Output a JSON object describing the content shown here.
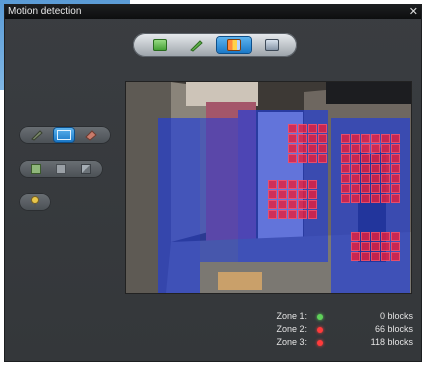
{
  "window": {
    "title": "Motion detection",
    "close_glyph": "✕"
  },
  "toolbar": {
    "buttons": [
      {
        "name": "export-icon",
        "active": false
      },
      {
        "name": "brush-icon",
        "active": false
      },
      {
        "name": "zones-icon",
        "active": true
      },
      {
        "name": "display-icon",
        "active": false
      }
    ]
  },
  "tools": {
    "group1": [
      "pencil-icon",
      "rectangle-icon",
      "eraser-icon"
    ],
    "group2": [
      "fill-icon",
      "clear-icon",
      "invert-icon"
    ],
    "group3": [
      "pin-icon"
    ]
  },
  "colors": {
    "zone_blue": "#1e3cdc",
    "motion_red": "#e81e3c",
    "active_blue": "#2a8ee0",
    "zone1_dot": "#5fd15a",
    "zone2_dot": "#ff3b3b",
    "zone3_dot": "#ff3b3b"
  },
  "zones": [
    {
      "label": "Zone 1:",
      "count": "0 blocks",
      "status": "green"
    },
    {
      "label": "Zone 2:",
      "count": "66 blocks",
      "status": "red"
    },
    {
      "label": "Zone 3:",
      "count": "118 blocks",
      "status": "red"
    }
  ]
}
